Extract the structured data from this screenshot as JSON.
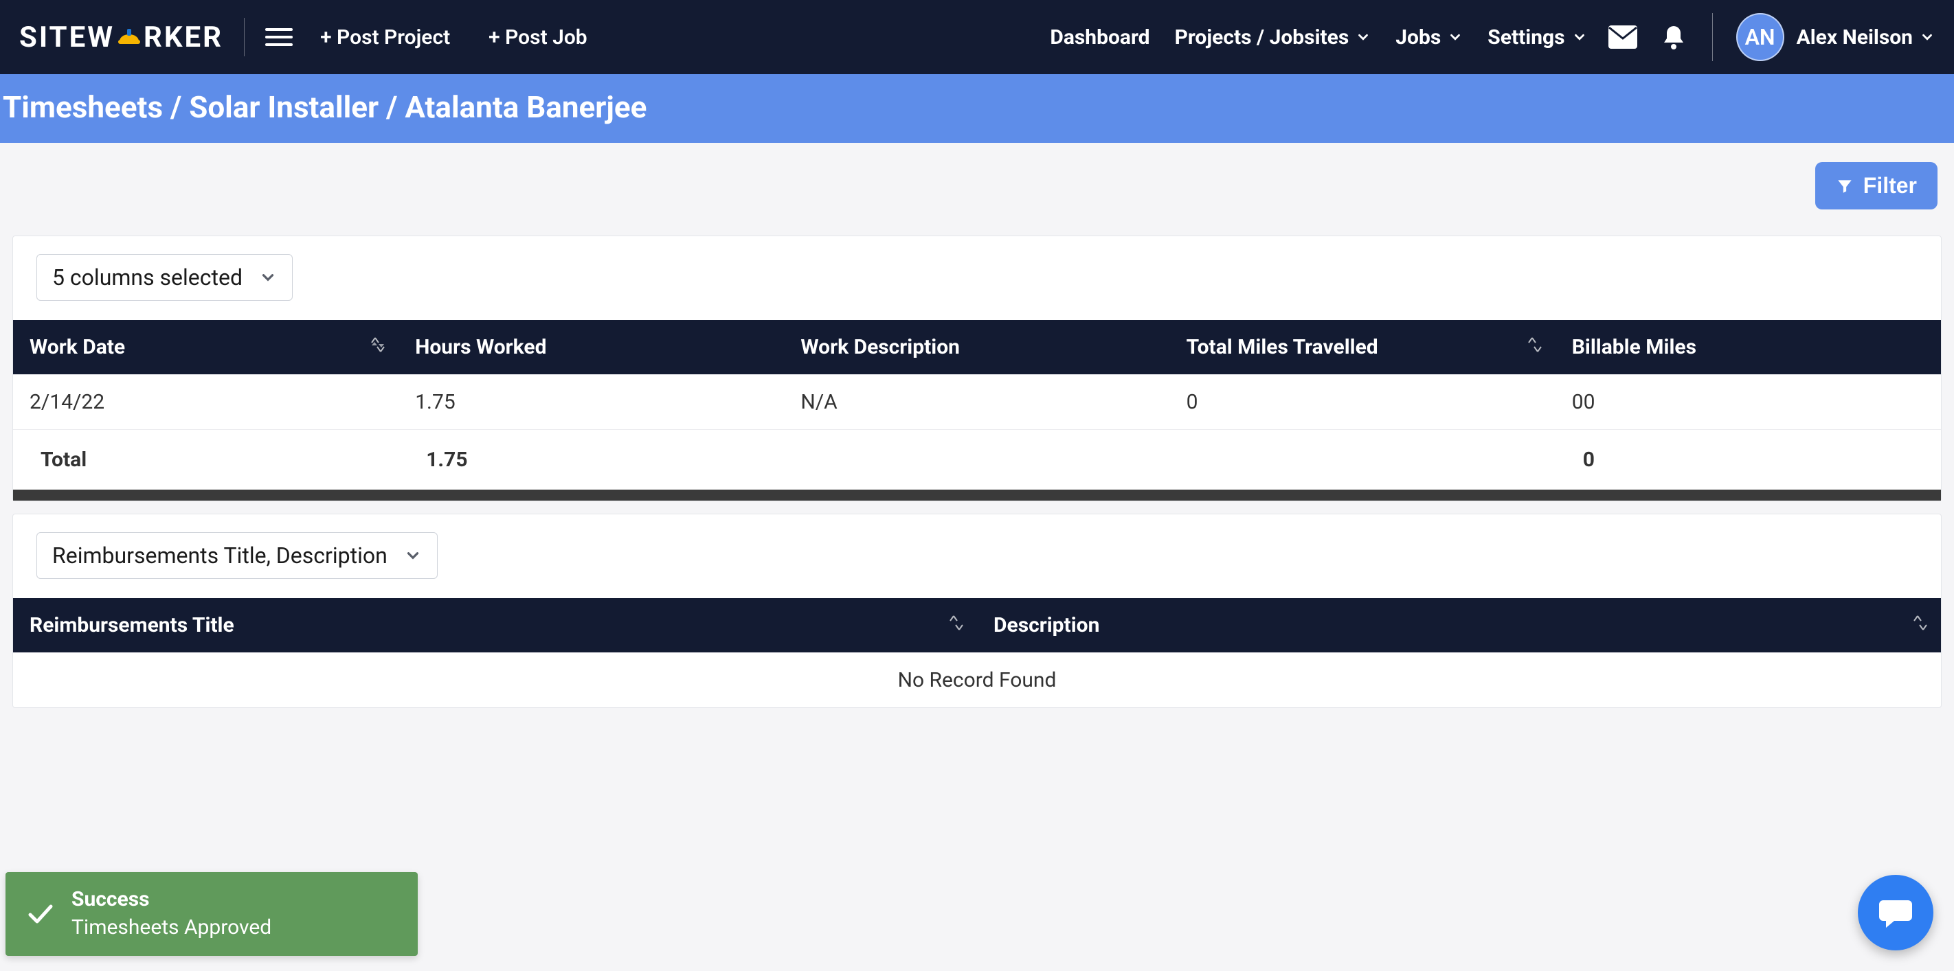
{
  "brand": {
    "name_left": "SITEW",
    "name_right": "RKER"
  },
  "nav": {
    "post_project": "+ Post Project",
    "post_job": "+ Post Job",
    "dashboard": "Dashboard",
    "projects": "Projects / Jobsites",
    "jobs": "Jobs",
    "settings": "Settings"
  },
  "user": {
    "initials": "AN",
    "name": "Alex Neilson"
  },
  "breadcrumb": "Timesheets / Solar Installer / Atalanta Banerjee",
  "filter_label": "Filter",
  "timesheet_columns_select": "5 columns selected",
  "timesheet_table": {
    "headers": {
      "work_date": "Work Date",
      "hours_worked": "Hours Worked",
      "work_description": "Work Description",
      "total_miles": "Total Miles Travelled",
      "billable_miles": "Billable Miles"
    },
    "rows": [
      {
        "work_date": "2/14/22",
        "hours_worked": "1.75",
        "work_description": "N/A",
        "total_miles": "0",
        "billable_miles": "00"
      }
    ],
    "totals": {
      "label": "Total",
      "hours_worked": "1.75",
      "billable_miles": "0"
    }
  },
  "reimb_select": "Reimbursements Title, Description",
  "reimb_table": {
    "headers": {
      "title": "Reimbursements Title",
      "description": "Description"
    },
    "empty": "No Record Found"
  },
  "toast": {
    "title": "Success",
    "message": "Timesheets Approved"
  }
}
